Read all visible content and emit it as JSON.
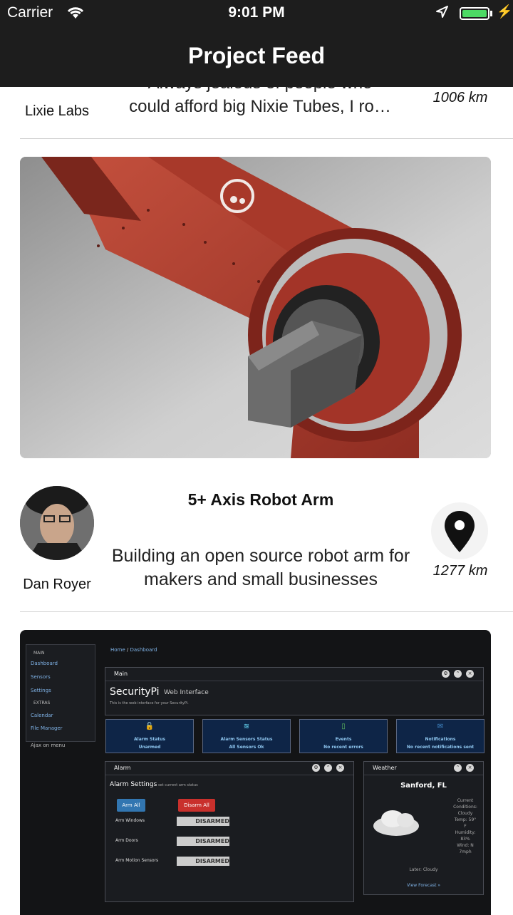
{
  "status_bar": {
    "carrier": "Carrier",
    "time": "9:01 PM",
    "battery_level": 1.0,
    "battery_color": "#4cd964"
  },
  "nav": {
    "title": "Project Feed"
  },
  "previous_item": {
    "author": "Lixie Labs",
    "description_partial": "Always jealous of people who",
    "description": "could afford big Nixie Tubes, I ro…",
    "distance": "1006 km"
  },
  "item": {
    "title": "5+ Axis Robot Arm",
    "author": "Dan Royer",
    "description": "Building an open source robot arm for makers and small businesses",
    "distance": "1277 km",
    "pin_icon": "map-pin-icon"
  },
  "securitypi": {
    "breadcrumb_home": "Home",
    "breadcrumb_sep": "/",
    "breadcrumb_page": "Dashboard",
    "sidebar": {
      "main_heading": "MAIN",
      "dashboard": "Dashboard",
      "sensors": "Sensors",
      "settings": "Settings",
      "extras_heading": "EXTRAS",
      "calendar": "Calendar",
      "file_manager": "File Manager",
      "ajax_menu": "Ajax on menu"
    },
    "main_panel_title": "Main",
    "app_name": "SecurityPi",
    "app_subtitle": "Web Interface",
    "app_caption": "This is the web interface for your SecurityPi.",
    "cards": [
      {
        "title": "Alarm Status",
        "value": "Unarmed",
        "color": "#d9534f"
      },
      {
        "title": "Alarm Sensors Status",
        "value": "All Sensors Ok",
        "color": "#5bc0de"
      },
      {
        "title": "Events",
        "value": "No recent errors",
        "color": "#5cb85c"
      },
      {
        "title": "Notifications",
        "value": "No recent notifications sent",
        "color": "#428bca"
      }
    ],
    "alarm_panel_title": "Alarm",
    "alarm_settings_label": "Alarm Settings",
    "alarm_settings_hint": "set current arm status",
    "arm_all": "Arm All",
    "disarm_all": "Disarm All",
    "toggles": [
      {
        "label": "Arm Windows",
        "state": "DISARMED"
      },
      {
        "label": "Arm Doors",
        "state": "DISARMED"
      },
      {
        "label": "Arm Motion Sensors",
        "state": "DISARMED"
      }
    ],
    "weather_title": "Weather",
    "weather_city": "Sanford, FL",
    "weather_lines": [
      "Current",
      "Conditions:",
      "Cloudy",
      "Temp: 59°",
      "F",
      "Humidity:",
      "83%",
      "Wind: N",
      "7mph"
    ],
    "weather_later": "Later: Cloudy",
    "weather_link": "View Forecast »"
  }
}
